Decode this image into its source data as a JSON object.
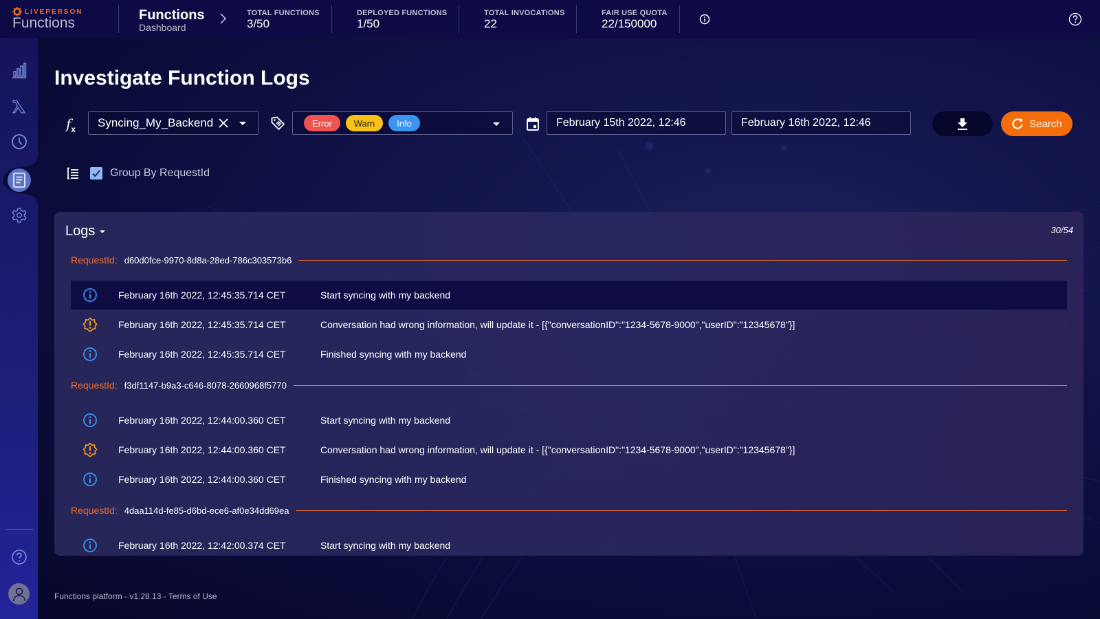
{
  "header": {
    "brand_company": "LIVEPERSON",
    "brand_product": "Functions",
    "breadcrumb_title": "Functions",
    "breadcrumb_subtitle": "Dashboard",
    "stats": [
      {
        "label": "TOTAL FUNCTIONS",
        "value": "3/50"
      },
      {
        "label": "DEPLOYED FUNCTIONS",
        "value": "1/50"
      },
      {
        "label": "TOTAL INVOCATIONS",
        "value": "22"
      },
      {
        "label": "FAIR USE QUOTA",
        "value": "22/150000"
      }
    ],
    "info_icon": "info-circle-icon",
    "help_icon": "help-circle-icon"
  },
  "sidebar": {
    "items": [
      {
        "name": "dashboard",
        "icon": "bar-chart-icon",
        "active": false
      },
      {
        "name": "functions",
        "icon": "lambda-icon",
        "active": false
      },
      {
        "name": "schedules",
        "icon": "clock-icon",
        "active": false
      },
      {
        "name": "logs",
        "icon": "document-icon",
        "active": true
      },
      {
        "name": "settings",
        "icon": "gear-icon",
        "active": false
      }
    ],
    "bottom": [
      {
        "name": "help",
        "icon": "help-circle-icon"
      },
      {
        "name": "account",
        "icon": "user-avatar-icon"
      }
    ]
  },
  "page": {
    "title": "Investigate Function Logs"
  },
  "filters": {
    "function_select": {
      "value": "Syncing_My_Backend"
    },
    "levels": [
      {
        "label": "Error",
        "color": "#ef5350"
      },
      {
        "label": "Warn",
        "color": "#f8c116"
      },
      {
        "label": "Info",
        "color": "#3b94ef"
      }
    ],
    "start_date": "February 15th 2022, 12:46",
    "end_date": "February 16th 2022, 12:46",
    "search_label": "Search",
    "group_by_label": "Group By RequestId",
    "group_by_checked": true
  },
  "logs": {
    "title": "Logs",
    "count": "30/54",
    "request_label": "RequestId:",
    "groups": [
      {
        "request_id": "d60d0fce-9970-8d8a-28ed-786c303573b6",
        "entries": [
          {
            "level": "info",
            "time": "February 16th 2022, 12:45:35.714 CET",
            "message": "Start syncing with my backend"
          },
          {
            "level": "warn",
            "time": "February 16th 2022, 12:45:35.714 CET",
            "message": "Conversation had wrong information, will update it - [{\"conversationID\":\"1234-5678-9000\",\"userID\":\"12345678\"}]"
          },
          {
            "level": "info",
            "time": "February 16th 2022, 12:45:35.714 CET",
            "message": "Finished syncing with my backend"
          }
        ]
      },
      {
        "request_id": "f3df1147-b9a3-c646-8078-2660968f5770",
        "entries": [
          {
            "level": "info",
            "time": "February 16th 2022, 12:44:00.360 CET",
            "message": "Start syncing with my backend"
          },
          {
            "level": "warn",
            "time": "February 16th 2022, 12:44:00.360 CET",
            "message": "Conversation had wrong information, will update it - [{\"conversationID\":\"1234-5678-9000\",\"userID\":\"12345678\"}]"
          },
          {
            "level": "info",
            "time": "February 16th 2022, 12:44:00.360 CET",
            "message": "Finished syncing with my backend"
          }
        ]
      },
      {
        "request_id": "4daa114d-fe85-d6bd-ece6-af0e34dd69ea",
        "entries": [
          {
            "level": "info",
            "time": "February 16th 2022, 12:42:00.374 CET",
            "message": "Start syncing with my backend"
          }
        ]
      }
    ]
  },
  "footer": {
    "text": "Functions platform - v1.28.13 - Terms of Use"
  },
  "colors": {
    "accent_orange": "#f36d0b",
    "info_blue": "#3b94ef",
    "warn_orange": "#f59a1b",
    "topbar_bg": "#0e0a46"
  }
}
